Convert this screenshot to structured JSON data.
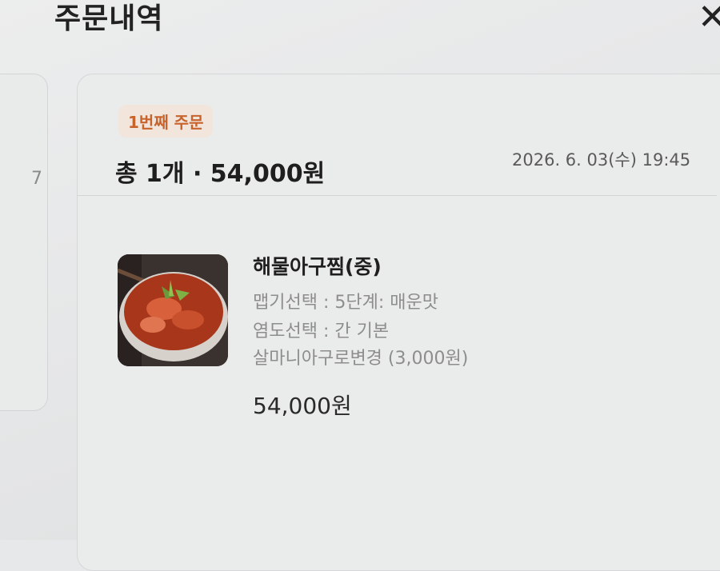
{
  "header": {
    "title": "주문내역",
    "close_icon": "close-icon"
  },
  "left_card": {
    "partial_text": "7"
  },
  "order": {
    "badge": "1번째 주문",
    "summary": "총 1개 · 54,000원",
    "date": "2026. 6. 03(수) 19:45",
    "items": [
      {
        "name": "해물아구찜(중)",
        "options": [
          "맵기선택 : 5단계: 매운맛",
          "염도선택 : 간 기본",
          "살마니아구로변경 (3,000원)"
        ],
        "price": "54,000원"
      }
    ]
  },
  "colors": {
    "accent": "#c8632b",
    "badge_bg": "#f1e5dc"
  }
}
